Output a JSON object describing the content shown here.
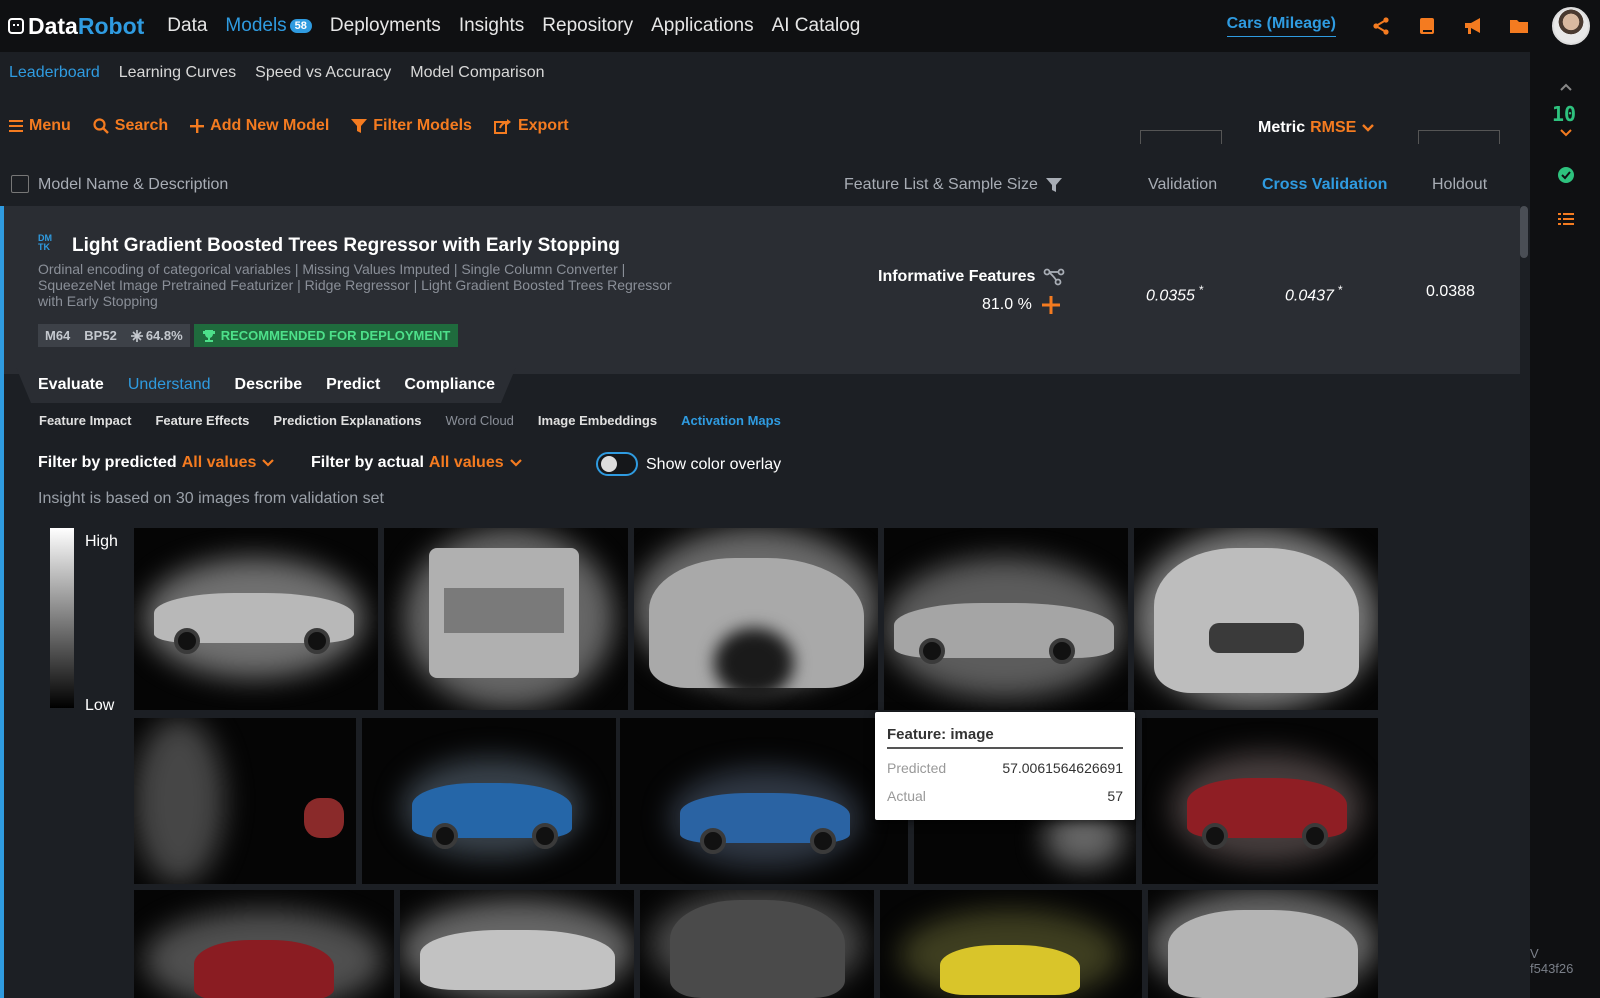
{
  "app": {
    "logo_data": "Data",
    "logo_robot": "Robot",
    "nav": [
      {
        "label": "Data"
      },
      {
        "label": "Models",
        "badge": "58"
      },
      {
        "label": "Deployments"
      },
      {
        "label": "Insights"
      },
      {
        "label": "Repository"
      },
      {
        "label": "Applications"
      },
      {
        "label": "AI Catalog"
      }
    ],
    "project": "Cars (Mileage)",
    "version": "V f543f26"
  },
  "rail": {
    "count": "10"
  },
  "subnav": [
    "Leaderboard",
    "Learning Curves",
    "Speed vs Accuracy",
    "Model Comparison"
  ],
  "toolbar": {
    "menu": "Menu",
    "search": "Search",
    "add": "Add New Model",
    "filter": "Filter Models",
    "export": "Export",
    "metric_label": "Metric",
    "metric_value": "RMSE"
  },
  "columns": {
    "name": "Model Name & Description",
    "feature": "Feature List & Sample Size",
    "validation": "Validation",
    "cross": "Cross Validation",
    "holdout": "Holdout"
  },
  "model": {
    "icon_text": "DM TK",
    "title": "Light Gradient Boosted Trees Regressor with Early Stopping",
    "description": "Ordinal encoding of categorical variables | Missing Values Imputed | Single Column Converter | SqueezeNet Image Pretrained Featurizer | Ridge Regressor | Light Gradient Boosted Trees Regressor with Early Stopping",
    "chip_id": "M64",
    "chip_bp": "BP52",
    "chip_pct": "64.8%",
    "recommended": "RECOMMENDED FOR DEPLOYMENT",
    "feature_list": "Informative Features",
    "feature_pct": "81.0 %",
    "validation": "0.0355",
    "validation_mark": "*",
    "cross": "0.0437",
    "cross_mark": "*",
    "holdout": "0.0388"
  },
  "tabs": [
    "Evaluate",
    "Understand",
    "Describe",
    "Predict",
    "Compliance"
  ],
  "subtabs": [
    "Feature Impact",
    "Feature Effects",
    "Prediction Explanations",
    "Word Cloud",
    "Image Embeddings",
    "Activation Maps"
  ],
  "filters": {
    "predicted_label": "Filter by predicted",
    "predicted_value": "All values",
    "actual_label": "Filter by actual",
    "actual_value": "All values",
    "overlay_label": "Show color overlay",
    "insight": "Insight is based on 30 images from validation set"
  },
  "legend": {
    "high": "High",
    "low": "Low"
  },
  "tooltip": {
    "title": "Feature: image",
    "predicted_label": "Predicted",
    "predicted_value": "57.0061564626691",
    "actual_label": "Actual",
    "actual_value": "57"
  },
  "colors": {
    "accent": "#2f9be0",
    "orange": "#f47b20",
    "green": "#2ec27e"
  }
}
